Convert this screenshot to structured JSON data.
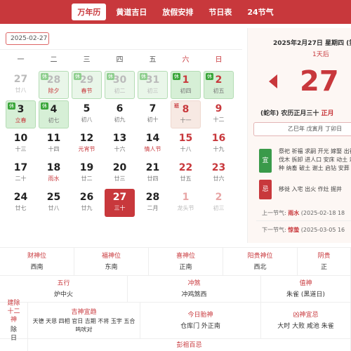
{
  "nav": {
    "tabs": [
      {
        "label": "万年历",
        "active": true
      },
      {
        "label": "黄道吉日",
        "active": false
      },
      {
        "label": "放假安排",
        "active": false
      },
      {
        "label": "节日表",
        "active": false
      },
      {
        "label": "24节气",
        "active": false
      }
    ]
  },
  "calendar": {
    "date_input": "2025-02-27",
    "weekdays": [
      "一",
      "二",
      "三",
      "四",
      "五",
      "六",
      "日"
    ],
    "days": [
      {
        "num": "27",
        "sub": "廿八",
        "other": true
      },
      {
        "num": "28",
        "sub": "除夕",
        "other": true,
        "badge": "休",
        "hol": true
      },
      {
        "num": "29",
        "sub": "春节",
        "other": true,
        "badge": "休",
        "hol": true
      },
      {
        "num": "30",
        "sub": "初二",
        "other": true,
        "badge": "休"
      },
      {
        "num": "31",
        "sub": "初三",
        "other": true,
        "badge": "休"
      },
      {
        "num": "1",
        "sub": "初四",
        "badge": "休",
        "wkend": true
      },
      {
        "num": "2",
        "sub": "初五",
        "badge": "休",
        "wkend": true
      },
      {
        "num": "3",
        "sub": "立春",
        "badge": "休",
        "hol": true
      },
      {
        "num": "4",
        "sub": "初七",
        "badge": "休"
      },
      {
        "num": "5",
        "sub": "初八"
      },
      {
        "num": "6",
        "sub": "初九"
      },
      {
        "num": "7",
        "sub": "初十"
      },
      {
        "num": "8",
        "sub": "十一",
        "badge": "班",
        "wkend": true
      },
      {
        "num": "9",
        "sub": "十二",
        "wkend": true
      },
      {
        "num": "10",
        "sub": "十三"
      },
      {
        "num": "11",
        "sub": "十四"
      },
      {
        "num": "12",
        "sub": "元宵节",
        "hol": true
      },
      {
        "num": "13",
        "sub": "十六"
      },
      {
        "num": "14",
        "sub": "情人节",
        "hol": true
      },
      {
        "num": "15",
        "sub": "十八",
        "wkend": true
      },
      {
        "num": "16",
        "sub": "十九",
        "wkend": true
      },
      {
        "num": "17",
        "sub": "二十"
      },
      {
        "num": "18",
        "sub": "雨水",
        "hol": true
      },
      {
        "num": "19",
        "sub": "廿二"
      },
      {
        "num": "20",
        "sub": "廿三"
      },
      {
        "num": "21",
        "sub": "廿四"
      },
      {
        "num": "22",
        "sub": "廿五",
        "wkend": true
      },
      {
        "num": "23",
        "sub": "廿六",
        "wkend": true
      },
      {
        "num": "24",
        "sub": "廿七"
      },
      {
        "num": "25",
        "sub": "廿八"
      },
      {
        "num": "26",
        "sub": "廿九"
      },
      {
        "num": "27",
        "sub": "三十",
        "today": true
      },
      {
        "num": "28",
        "sub": "二月"
      },
      {
        "num": "1",
        "sub": "龙头节",
        "other": true,
        "wkend": true
      },
      {
        "num": "2",
        "sub": "初三",
        "other": true,
        "wkend": true
      }
    ]
  },
  "detail": {
    "date_line": "2025年2月27日 星期四 (第",
    "after": "1天后",
    "big_day": "27",
    "lunar_prefix": "(蛇年) 农历正月三十 ",
    "lunar_red": "正月",
    "ganzhi": "乙巳年 戊寅月 丁卯日",
    "yi_label": "宜",
    "yi_text": "祭祀 祈福 求嗣 开光 嫁娶 出行 伐木 拆卸 进人口 安床 动土 栽种 纳畜 破土 谢土 启钻 安葬",
    "ji_label": "忌",
    "ji_text": "移徙 入宅 出火 作灶 掘井",
    "prev_term_label": "上一节气:",
    "prev_term_name": "雨水",
    "prev_term_date": "(2025-02-18 18",
    "next_term_label": "下一节气:",
    "next_term_name": "惊蛰",
    "next_term_date": "(2025-03-05 16"
  },
  "info": {
    "gods": [
      {
        "label": "财神位",
        "value": "西南"
      },
      {
        "label": "福神位",
        "value": "东南"
      },
      {
        "label": "喜神位",
        "value": "正南"
      },
      {
        "label": "阳贵神位",
        "value": "西北"
      },
      {
        "label": "阴贵",
        "value": "正"
      }
    ],
    "wuxing_label": "五行",
    "wuxing_value": "炉中火",
    "chongsha_label": "冲煞",
    "chongsha_value": "冲鸡煞西",
    "zhishen_label": "值神",
    "zhishen_value": "朱雀 (黑道日)",
    "jianchu_label": "建除十二神",
    "jianchu_value": "除日",
    "jishen_label": "吉神宜趋",
    "jishen_value": "天德 天恩 四相 官日 吉期 不将 玉宇 五合 鸣吠对",
    "taishen_label": "今日胎神",
    "taishen_value": "仓库门 外正南",
    "xiongsha_label": "凶神宜忌",
    "xiongsha_value": "大时 大败 咸池 朱雀",
    "pengzu_label": "彭祖百忌"
  }
}
